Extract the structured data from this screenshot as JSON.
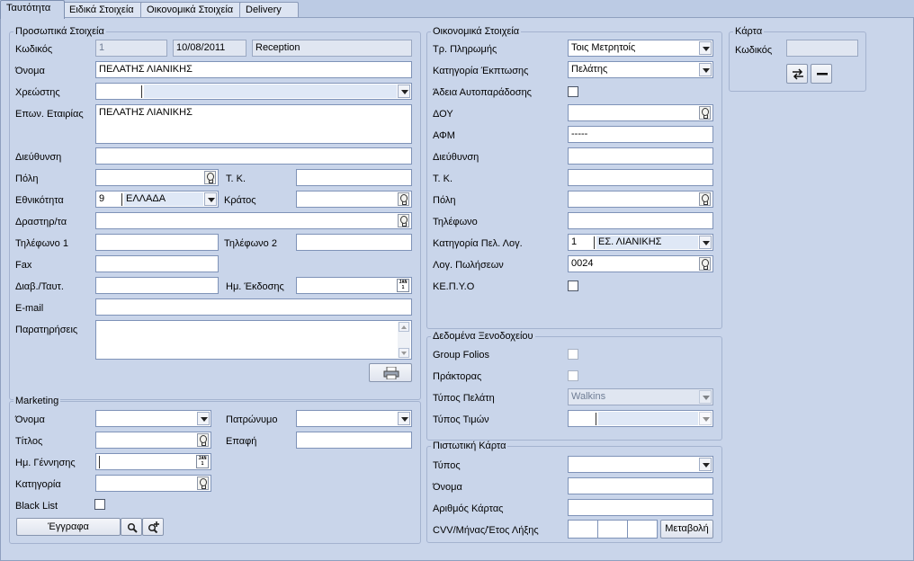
{
  "tabs": [
    "Ταυτότητα",
    "Ειδικά Στοιχεία",
    "Οικονομικά Στοιχεία",
    "Delivery"
  ],
  "personal": {
    "group_title": "Προσωπικά Στοιχεία",
    "code_label": "Κωδικός",
    "code_value": "1",
    "date_value": "10/08/2011",
    "user_value": "Reception",
    "name_label": "Όνομα",
    "name_value": "ΠΕΛΑΤΗΣ ΛΙΑΝΙΚΗΣ",
    "debtor_label": "Χρεώστης",
    "debtor_value": "",
    "company_label": "Επων. Εταιρίας",
    "company_value": "ΠΕΛΑΤΗΣ ΛΙΑΝΙΚΗΣ",
    "address_label": "Διεύθυνση",
    "city_label": "Πόλη",
    "zip_label": "Τ. Κ.",
    "nationality_label": "Εθνικότητα",
    "nationality_code": "9",
    "nationality_value": "ΕΛΛΑΔΑ",
    "country_label": "Κράτος",
    "activity_label": "Δραστηρ/τα",
    "phone1_label": "Τηλέφωνο 1",
    "phone2_label": "Τηλέφωνο 2",
    "fax_label": "Fax",
    "passport_label": "Διαβ./Ταυτ.",
    "issue_date_label": "Ημ. Έκδοσης",
    "email_label": "E-mail",
    "notes_label": "Παρατηρήσεις"
  },
  "marketing": {
    "group_title": "Marketing",
    "name_label": "Όνομα",
    "patronymic_label": "Πατρώνυμο",
    "title_label": "Τίτλος",
    "contact_label": "Επαφή",
    "birth_label": "Ημ. Γέννησης",
    "category_label": "Κατηγορία",
    "blacklist_label": "Black List",
    "documents_button": "Έγγραφα"
  },
  "financial": {
    "group_title": "Οικονομικά Στοιχεία",
    "payment_label": "Τρ. Πληρωμής",
    "payment_value": "Τοις Μετρητοίς",
    "discount_label": "Κατηγορία Έκπτωσης",
    "discount_value": "Πελάτης",
    "selfdelivery_label": "Άδεια Αυτοπαράδοσης",
    "doy_label": "ΔΟΥ",
    "afm_label": "ΑΦΜ",
    "afm_value": "-----",
    "address_label": "Διεύθυνση",
    "zip_label": "Τ. Κ.",
    "city_label": "Πόλη",
    "phone_label": "Τηλέφωνο",
    "account_cat_label": "Κατηγορία Πελ. Λογ.",
    "account_cat_code": "1",
    "account_cat_value": "ΕΣ. ΛΙΑΝΙΚΗΣ",
    "sales_acc_label": "Λογ. Πωλήσεων",
    "sales_acc_value": "0024",
    "kepyo_label": "ΚΕ.Π.Υ.Ο"
  },
  "hotel": {
    "group_title": "Δεδομένα Ξενοδοχείου",
    "group_folios_label": "Group Folios",
    "agents_label": "Πράκτορας",
    "customer_type_label": "Τύπος Πελάτη",
    "customer_type_value": "Walkins",
    "price_type_label": "Τύπος Τιμών",
    "price_type_value": ""
  },
  "credit": {
    "group_title": "Πιστωτική Κάρτα",
    "type_label": "Τύπος",
    "name_label": "Όνομα",
    "number_label": "Αριθμός Κάρτας",
    "cvv_label": "CVV/Μήνας/Έτος Λήξης",
    "change_button": "Μεταβολή"
  },
  "card": {
    "group_title": "Κάρτα",
    "code_label": "Κωδικός"
  },
  "icons": {
    "calendar_text": "JAN\n1"
  }
}
